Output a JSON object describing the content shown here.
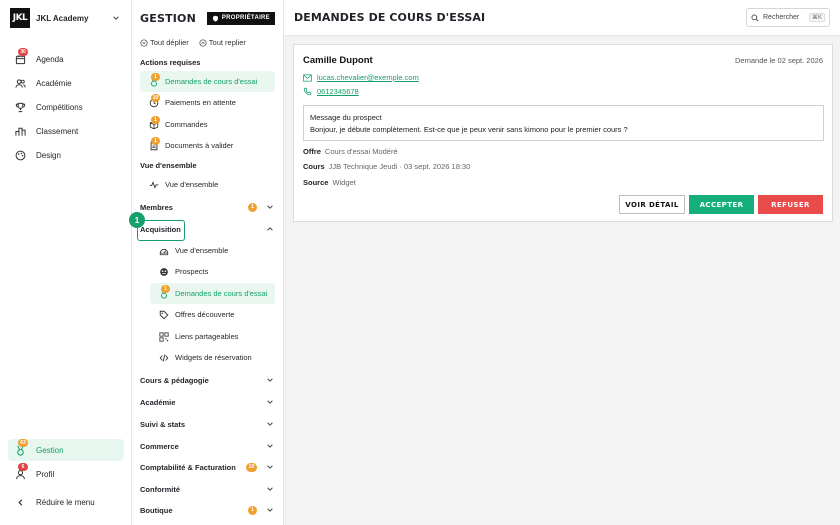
{
  "org": {
    "logo": "JKL",
    "name": "JKL Academy"
  },
  "rail": {
    "items": [
      {
        "label": "Agenda",
        "icon": "calendar-icon",
        "badge": "30"
      },
      {
        "label": "Académie",
        "icon": "users-icon"
      },
      {
        "label": "Compétitions",
        "icon": "trophy-icon"
      },
      {
        "label": "Classement",
        "icon": "podium-icon"
      },
      {
        "label": "Design",
        "icon": "palette-icon"
      }
    ],
    "bottom": [
      {
        "label": "Gestion",
        "icon": "medal-icon",
        "badge": "63"
      },
      {
        "label": "Profil",
        "icon": "user-icon",
        "badge": "6"
      }
    ],
    "collapse_label": "Réduire le menu"
  },
  "nav": {
    "title": "GESTION",
    "owner_badge": "PROPRIÉTAIRE",
    "expand_all": "Tout déplier",
    "collapse_all": "Tout replier",
    "sections": {
      "actions_title": "Actions requises",
      "actions": [
        {
          "label": "Demandes de cours d'essai",
          "badge": "1"
        },
        {
          "label": "Paiements en attente",
          "badge": "10"
        },
        {
          "label": "Commandes",
          "badge": "1"
        },
        {
          "label": "Documents à valider",
          "badge": "1"
        }
      ],
      "overview_title": "Vue d'ensemble",
      "overview_item": "Vue d'ensemble",
      "membres": {
        "label": "Membres",
        "count": "1"
      },
      "acquisition": {
        "label": "Acquisition",
        "items": [
          {
            "label": "Vue d'ensemble"
          },
          {
            "label": "Prospects"
          },
          {
            "label": "Demandes de cours d'essai",
            "badge": "1"
          },
          {
            "label": "Offres découverte"
          },
          {
            "label": "Liens partageables"
          },
          {
            "label": "Widgets de réservation"
          }
        ]
      },
      "groups": [
        {
          "label": "Cours & pédagogie"
        },
        {
          "label": "Académie"
        },
        {
          "label": "Suivi & stats"
        },
        {
          "label": "Commerce"
        },
        {
          "label": "Comptabilité & Facturation",
          "count": "10"
        },
        {
          "label": "Conformité"
        },
        {
          "label": "Boutique",
          "count": "1"
        }
      ]
    },
    "focus_step": "1"
  },
  "main": {
    "title": "DEMANDES DE COURS D'ESSAI",
    "search_placeholder": "Rechercher",
    "search_shortcut": "⌘K",
    "request": {
      "name": "Camille Dupont",
      "date": "Demande le 02 sept. 2026",
      "email": "lucas.chevalier@exemple.com",
      "phone": "0612345678",
      "message_title": "Message du prospect",
      "message": "Bonjour, je débute complètement. Est-ce que je peux venir sans kimono pour le premier cours ?",
      "offer_label": "Offre",
      "offer_value": "Cours d'essai Modéré",
      "course_label": "Cours",
      "course_value": "JJB Technique Jeudi · 03 sept. 2026 18:30",
      "source_label": "Source",
      "source_value": "Widget"
    },
    "buttons": {
      "detail": "VOIR DÉTAIL",
      "accept": "ACCEPTER",
      "refuse": "REFUSER"
    }
  },
  "colors": {
    "accent": "#15b07a",
    "danger": "#e94a4a",
    "badge": "#f0a030",
    "badge_red": "#e04545"
  }
}
